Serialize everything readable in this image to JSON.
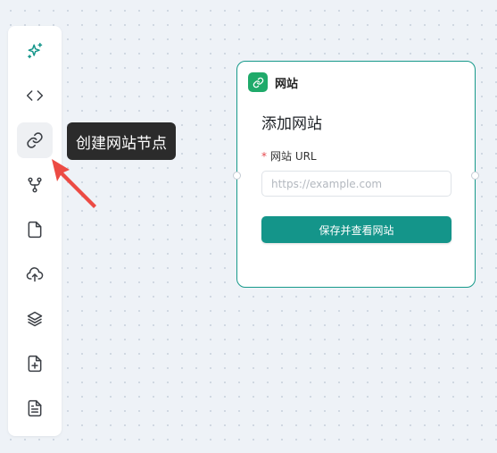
{
  "toolbar": {
    "items": [
      {
        "icon": "sparkle-icon"
      },
      {
        "icon": "code-icon"
      },
      {
        "icon": "link-icon"
      },
      {
        "icon": "branch-icon"
      },
      {
        "icon": "file-icon"
      },
      {
        "icon": "cloud-upload-icon"
      },
      {
        "icon": "layers-icon"
      },
      {
        "icon": "file-plus-icon"
      },
      {
        "icon": "file-text-icon"
      }
    ],
    "tooltip": "创建网站节点"
  },
  "node": {
    "title": "网站",
    "heading": "添加网站",
    "required_mark": "*",
    "field_label": "网站 URL",
    "url_placeholder": "https://example.com",
    "url_value": "",
    "submit_label": "保存并查看网站"
  },
  "colors": {
    "accent": "#14958a",
    "node_border": "#16998a",
    "node_icon_bg": "#1faa6a",
    "annotation_arrow": "#ec4b44",
    "sparkle": "#14958a"
  }
}
